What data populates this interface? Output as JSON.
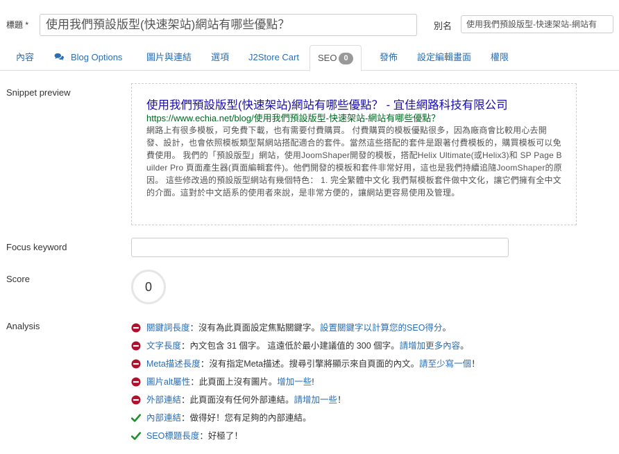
{
  "form": {
    "title_label": "標題 *",
    "title_value": "使用我們預設版型(快速架站)網站有哪些優點？",
    "alias_label": "別名",
    "alias_value": "使用我們預設版型-快速架站-網站有"
  },
  "tabs": [
    {
      "label": "內容"
    },
    {
      "label": "Blog Options",
      "icon": "comments-icon"
    },
    {
      "label": "圖片與連結"
    },
    {
      "label": "選項"
    },
    {
      "label": "J2Store Cart"
    },
    {
      "label": "SEO",
      "badge": "0",
      "active": true
    },
    {
      "label": "發佈"
    },
    {
      "label": "設定編輯畫面"
    },
    {
      "label": "權限"
    }
  ],
  "seo": {
    "snippet_label": "Snippet preview",
    "snippet": {
      "title": "使用我們預設版型(快速架站)網站有哪些優點？ - 宜佳網路科技有限公司",
      "url": "https://www.echia.net/blog/使用我們預設版型-快速架站-網站有哪些優點？",
      "description": "網路上有很多模板，可免費下載，也有需要付費購買。 付費購買的模板優點很多，因為廠商會比較用心去開發、設計，也會依照模板類型幫網站搭配適合的套件。當然這些搭配的套件是跟著付費模板的，購買模板可以免費使用。 我們的「預設版型」網站，使用JoomShaper開發的模板，搭配Helix Ultimate(或Helix3)和 SP Page Builder Pro 頁面產生器(頁面編輯套件)。他們開發的模板和套件非常好用，這也是我們持續追隨JoomShaper的原因。 這些修改過的預設版型網站有幾個特色： 1. 完全繁體中文化 我們幫模板套件做中文化，讓它們擁有全中文的介面。這對於中文語系的使用者來說，是非常方便的，讓網站更容易使用及管理。"
    },
    "focus_keyword_label": "Focus keyword",
    "focus_keyword_value": "",
    "score_label": "Score",
    "score_value": "0",
    "analysis_label": "Analysis",
    "analysis": [
      {
        "status": "bad",
        "title": "關鍵詞長度",
        "text": "：沒有為此頁面設定焦點關鍵字。",
        "link": "設置關鍵字以計算您的SEO得分",
        "tail": "。"
      },
      {
        "status": "bad",
        "title": "文字長度",
        "text": "：內文包含 31 個字。 這遠低於最小建議值的 300 個字。",
        "link": "請增加更多內容",
        "tail": "。"
      },
      {
        "status": "bad",
        "title": "Meta描述長度",
        "text": "：沒有指定Meta描述。搜尋引擎將顯示來自頁面的內文。",
        "link": "請至少寫一個",
        "tail": "！"
      },
      {
        "status": "bad",
        "title": "圖片alt屬性",
        "text": "：此頁面上沒有圖片。",
        "link": "增加一些",
        "tail": "!"
      },
      {
        "status": "bad",
        "title": "外部連結",
        "text": "：此頁面沒有任何外部連結。",
        "link": "請增加一些",
        "tail": "！"
      },
      {
        "status": "good",
        "title": "內部連結",
        "text": "：做得好！您有足夠的內部連結。",
        "link": "",
        "tail": ""
      },
      {
        "status": "good",
        "title": "SEO標題長度",
        "text": "：好極了！",
        "link": "",
        "tail": ""
      }
    ]
  },
  "colors": {
    "bad": "#b0102b",
    "good": "#1f8f2a",
    "link": "#2a6db5"
  }
}
